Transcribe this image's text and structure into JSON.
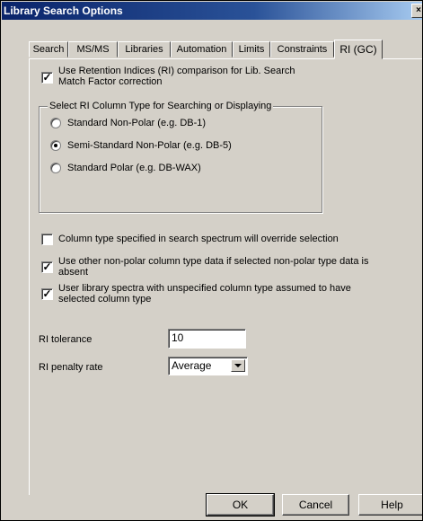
{
  "window": {
    "title": "Library Search Options",
    "close_glyph": "×"
  },
  "tabs": [
    {
      "label": "Search"
    },
    {
      "label": "MS/MS"
    },
    {
      "label": "Libraries"
    },
    {
      "label": "Automation"
    },
    {
      "label": "Limits"
    },
    {
      "label": "Constraints"
    },
    {
      "label": "RI (GC)",
      "active": true
    }
  ],
  "ri_comparison": {
    "label_line1": "Use Retention Indices (RI) comparison for Lib. Search",
    "label_line2": "Match Factor correction",
    "checked": true
  },
  "column_type_group": {
    "legend": "Select RI Column Type for Searching or Displaying",
    "options": [
      {
        "label": "Standard Non-Polar (e.g. DB-1)",
        "selected": false
      },
      {
        "label": "Semi-Standard Non-Polar (e.g. DB-5)",
        "selected": true
      },
      {
        "label": "Standard Polar (e.g. DB-WAX)",
        "selected": false
      }
    ]
  },
  "override_option": {
    "label": "Column type specified in search spectrum will override selection",
    "checked": false
  },
  "nonpolar_option": {
    "label_line1": "Use other non-polar column type data if selected non-polar type data is",
    "label_line2": "absent",
    "checked": true
  },
  "unspecified_option": {
    "label_line1": "User library spectra with unspecified column type assumed to have",
    "label_line2": "selected column type",
    "checked": true
  },
  "ri_tolerance": {
    "label": "RI tolerance",
    "value": "10"
  },
  "ri_penalty": {
    "label": "RI penalty rate",
    "value": "Average"
  },
  "buttons": {
    "ok": "OK",
    "cancel": "Cancel",
    "help": "Help"
  }
}
